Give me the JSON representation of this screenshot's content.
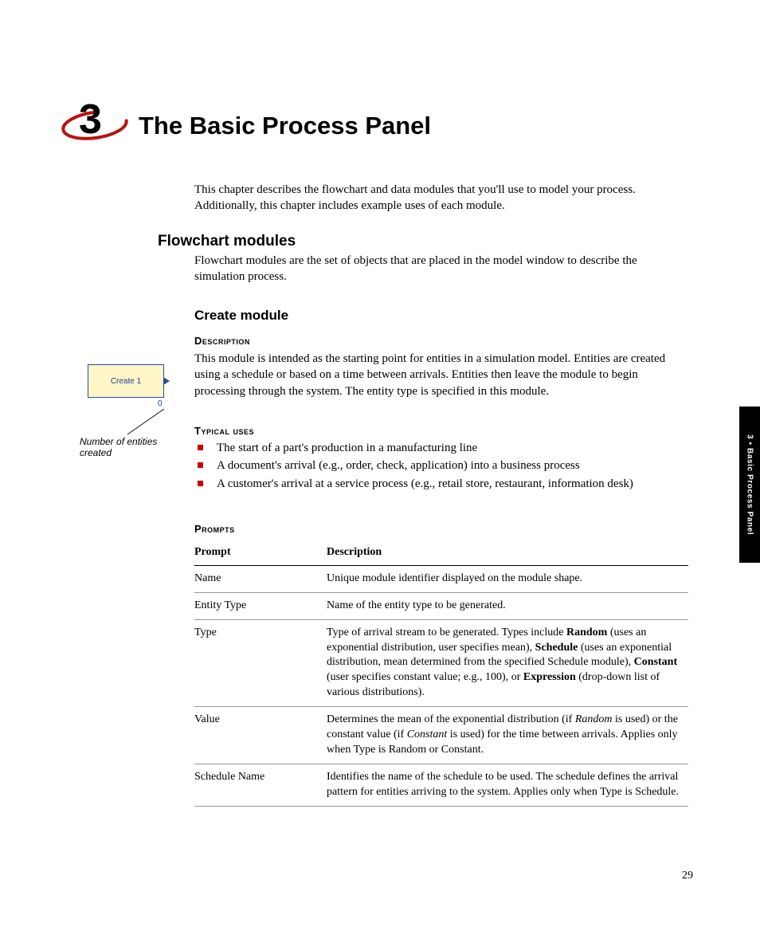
{
  "chapter": {
    "number": "3",
    "title": "The Basic Process Panel"
  },
  "intro": "This chapter describes the flowchart and data modules that you'll use to model your process. Additionally, this chapter includes example uses of each module.",
  "sections": {
    "flowchart_heading": "Flowchart modules",
    "flowchart_desc": "Flowchart modules are the set of objects that are placed in the model window to describe the simulation process.",
    "create_heading": "Create module",
    "description_heading": "Description",
    "create_desc": "This module is intended as the starting point for entities in a simulation model. Entities are created using a schedule or based on a time between arrivals. Entities then leave the module to begin processing through the system. The entity type is specified in this module.",
    "typical_uses_heading": "Typical uses",
    "typical_uses": [
      "The start of a part's production in a manufacturing line",
      "A document's arrival (e.g., order, check, application) into a business process",
      "A customer's arrival at a service process (e.g., retail store, restaurant, information desk)"
    ],
    "prompts_heading": "Prompts",
    "prompts_cols": {
      "prompt": "Prompt",
      "desc": "Description"
    },
    "prompts": [
      {
        "p": "Name",
        "d": "Unique module identifier displayed on the module shape."
      },
      {
        "p": "Entity Type",
        "d": "Name of the entity type to be generated."
      },
      {
        "p": "Type",
        "d": "Type of arrival stream to be generated. Types include <b>Random</b> (uses an exponential distribution, user specifies mean), <b>Schedule</b> (uses an exponential distribution, mean determined from the specified Schedule module), <b>Constant</b> (user specifies constant value; e.g., 100), or <b>Expression</b> (drop-down list of various distributions)."
      },
      {
        "p": "Value",
        "d": "Determines the mean of the exponential distribution (if <i>Random</i> is used) or the constant value (if <i>Constant</i> is used) for the time between arrivals. Applies only when Type is Random or Constant."
      },
      {
        "p": "Schedule Name",
        "d": "Identifies the name of the schedule to be used. The schedule defines the arrival pattern for entities arriving to the system. Applies only when Type is Schedule."
      }
    ]
  },
  "figure": {
    "module_label": "Create 1",
    "count": "0",
    "caption": "Number of entities created"
  },
  "tab": "3 • Basic Process Panel",
  "page_number": "29"
}
